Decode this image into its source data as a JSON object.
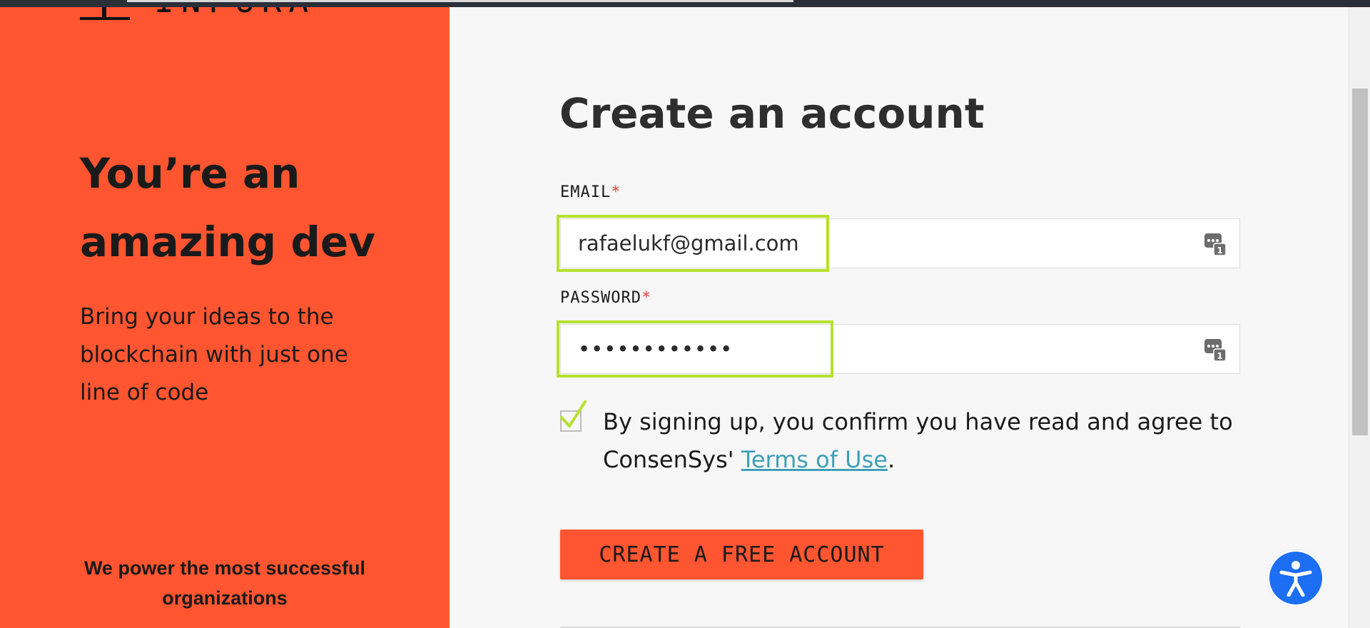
{
  "brand": {
    "logo_text": "INFURA"
  },
  "hero": {
    "headline_line1": "You’re an",
    "headline_line2": "amazing dev",
    "subtext_line1": "Bring your ideas to the",
    "subtext_line2": "blockchain with just one",
    "subtext_line3": "line of code",
    "power_line1": "We power the most successful",
    "power_line2": "organizations"
  },
  "form": {
    "title": "Create an account",
    "email_label": "EMAIL",
    "password_label": "PASSWORD",
    "required_mark": "*",
    "email_value": "rafaelukf@gmail.com",
    "password_value": "••••••••••••",
    "consent_line1": "By signing up, you confirm you have read and agree to",
    "consent_line2_prefix": "ConsenSys' ",
    "terms_link": "Terms of Use",
    "consent_line2_suffix": ".",
    "consent_checked": true,
    "submit_label": "CREATE A FREE ACCOUNT"
  },
  "colors": {
    "brand_orange": "#ff5530",
    "autofill_highlight": "#b7e02f",
    "link": "#3ea0b8",
    "accessibility_button": "#1c6ef2"
  },
  "icons": {
    "password_manager": "password-manager-icon",
    "accessibility": "accessibility-icon",
    "checkmark": "checkmark-icon"
  }
}
